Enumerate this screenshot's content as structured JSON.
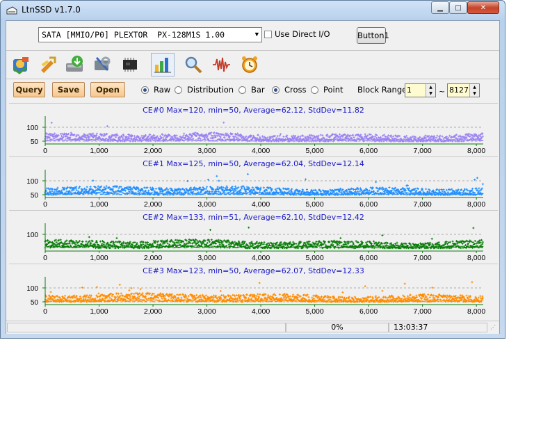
{
  "window": {
    "title": "LtnSSD v1.7.0",
    "min_label": "▁",
    "max_label": "□",
    "close_label": "✕"
  },
  "toolbar": {
    "device": "SATA [MMIO/P0] PLEXTOR  PX-128M1S 1.00",
    "use_direct_io_label": "Use Direct I/O",
    "use_direct_io_checked": false,
    "button1_label": "Button1",
    "icons": [
      "disk-info-icon",
      "tools-icon",
      "drive-download-icon",
      "settings-icon",
      "chip-icon",
      "chart-bars-icon",
      "magnifier-icon",
      "waveform-icon",
      "alarm-clock-icon"
    ],
    "active_icon": "chart-bars-icon"
  },
  "controls": {
    "query_label": "Query",
    "save_label": "Save",
    "open_label": "Open",
    "mode_options": [
      {
        "label": "Raw",
        "selected": true
      },
      {
        "label": "Distribution",
        "selected": false
      }
    ],
    "style_options": [
      {
        "label": "Bar",
        "selected": false
      },
      {
        "label": "Cross",
        "selected": true
      },
      {
        "label": "Point",
        "selected": false
      }
    ],
    "block_range_label": "Block Range",
    "block_range_from": "1",
    "block_range_to": "8127",
    "tilde": "~"
  },
  "chart_data": [
    {
      "type": "scatter",
      "title": "CE#0 Max=120, min=50, Average=62.12, StdDev=11.82",
      "color": "#9a82f2",
      "x_ticks": [
        0,
        1000,
        2000,
        3000,
        4000,
        5000,
        6000,
        7000,
        8000
      ],
      "x_tick_labels": [
        "0",
        "1,000",
        "2,000",
        "3,000",
        "4,000",
        "5,000",
        "6,000",
        "7,000",
        "8,000"
      ],
      "y_ticks": [
        100,
        50
      ],
      "y_tick_labels": [
        "100",
        "50"
      ],
      "xlim": [
        0,
        8127
      ],
      "ylim": [
        40,
        140
      ],
      "max": 120,
      "min": 50,
      "average": 62.12,
      "stddev": 11.82,
      "grid": true
    },
    {
      "type": "scatter",
      "title": "CE#1 Max=125, min=50, Average=62.04, StdDev=12.14",
      "color": "#1f8fff",
      "x_ticks": [
        0,
        1000,
        2000,
        3000,
        4000,
        5000,
        6000,
        7000,
        8000
      ],
      "x_tick_labels": [
        "0",
        "1,000",
        "2,000",
        "3,000",
        "4,000",
        "5,000",
        "6,000",
        "7,000",
        "8,000"
      ],
      "y_ticks": [
        100,
        50
      ],
      "y_tick_labels": [
        "100",
        "50"
      ],
      "xlim": [
        0,
        8127
      ],
      "ylim": [
        40,
        140
      ],
      "max": 125,
      "min": 50,
      "average": 62.04,
      "stddev": 12.14,
      "grid": true
    },
    {
      "type": "scatter",
      "title": "CE#2 Max=133, min=51, Average=62.10, StdDev=12.42",
      "color": "#0a7d0a",
      "x_ticks": [
        0,
        1000,
        2000,
        3000,
        4000,
        5000,
        6000,
        7000,
        8000
      ],
      "x_tick_labels": [
        "0",
        "1,000",
        "2,000",
        "3,000",
        "4,000",
        "5,000",
        "6,000",
        "7,000",
        "8,000"
      ],
      "y_ticks": [
        100
      ],
      "y_tick_labels": [
        "100"
      ],
      "xlim": [
        0,
        8127
      ],
      "ylim": [
        40,
        140
      ],
      "max": 133,
      "min": 51,
      "average": 62.1,
      "stddev": 12.42,
      "grid": true
    },
    {
      "type": "scatter",
      "title": "CE#3 Max=123, min=50, Average=62.07, StdDev=12.33",
      "color": "#ff8c00",
      "x_ticks": [
        0,
        1000,
        2000,
        3000,
        4000,
        5000,
        6000,
        7000,
        8000
      ],
      "x_tick_labels": [
        "0",
        "1,000",
        "2,000",
        "3,000",
        "4,000",
        "5,000",
        "6,000",
        "7,000",
        "8,000"
      ],
      "y_ticks": [
        100,
        50
      ],
      "y_tick_labels": [
        "100",
        "50"
      ],
      "xlim": [
        0,
        8127
      ],
      "ylim": [
        40,
        140
      ],
      "max": 123,
      "min": 50,
      "average": 62.07,
      "stddev": 12.33,
      "grid": true
    }
  ],
  "status": {
    "progress_text": "0%",
    "time": "13:03:37"
  }
}
